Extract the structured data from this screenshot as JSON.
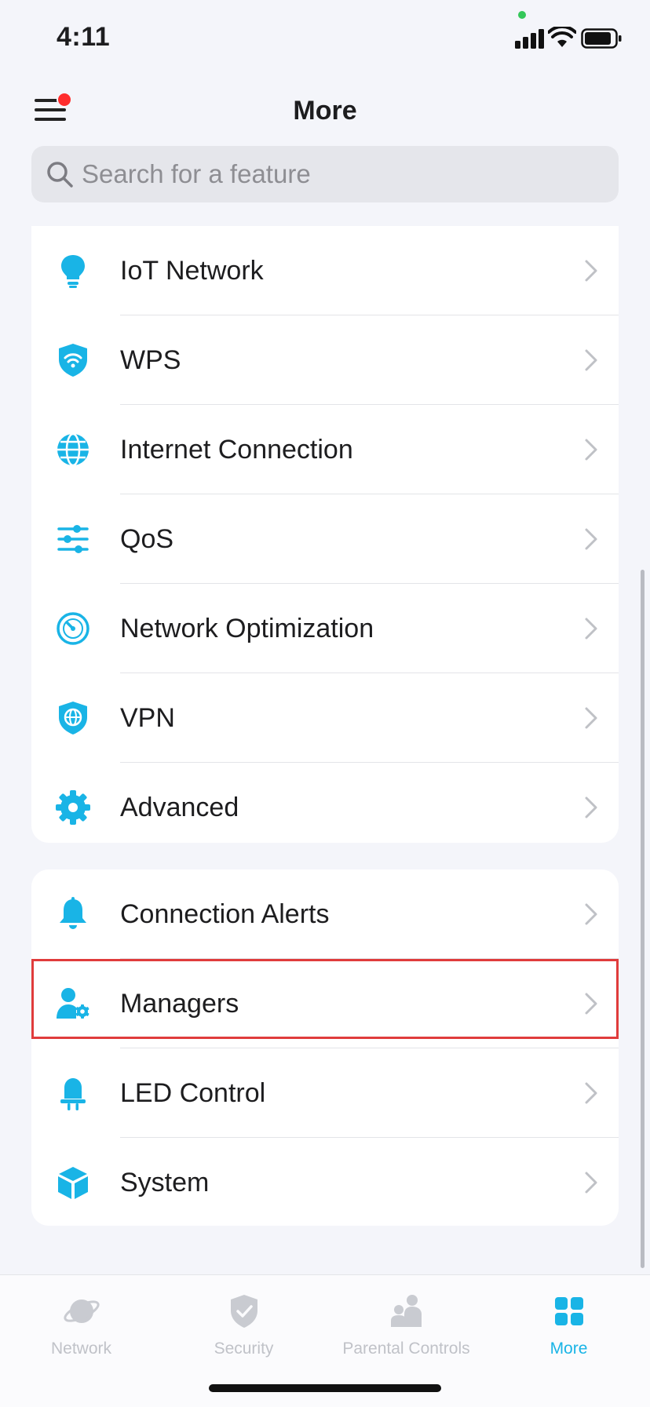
{
  "status_bar": {
    "time": "4:11"
  },
  "header": {
    "title": "More",
    "menu_icon": "hamburger-menu-icon",
    "notification_dot_color": "#ff2d2d"
  },
  "search": {
    "placeholder": "Search for a feature",
    "value": ""
  },
  "colors": {
    "accent": "#19b4e6",
    "background": "#f4f5fa",
    "highlight_border": "#e03c3c",
    "tab_inactive": "#c0c2c8"
  },
  "section1": {
    "items": [
      {
        "label": "IoT Network",
        "icon": "lightbulb-icon"
      },
      {
        "label": "WPS",
        "icon": "wifi-shield-icon"
      },
      {
        "label": "Internet Connection",
        "icon": "globe-icon"
      },
      {
        "label": "QoS",
        "icon": "sliders-icon"
      },
      {
        "label": "Network Optimization",
        "icon": "gauge-icon"
      },
      {
        "label": "VPN",
        "icon": "globe-shield-icon"
      },
      {
        "label": "Advanced",
        "icon": "gear-icon"
      }
    ]
  },
  "section2": {
    "items": [
      {
        "label": "Connection Alerts",
        "icon": "bell-icon"
      },
      {
        "label": "Managers",
        "icon": "user-gear-icon",
        "highlighted": true
      },
      {
        "label": "LED Control",
        "icon": "led-icon"
      },
      {
        "label": "System",
        "icon": "cube-icon"
      }
    ]
  },
  "tabbar": {
    "tabs": [
      {
        "label": "Network",
        "icon": "planet-icon",
        "active": false
      },
      {
        "label": "Security",
        "icon": "shield-check-icon",
        "active": false
      },
      {
        "label": "Parental Controls",
        "icon": "family-icon",
        "active": false
      },
      {
        "label": "More",
        "icon": "grid-icon",
        "active": true
      }
    ]
  }
}
